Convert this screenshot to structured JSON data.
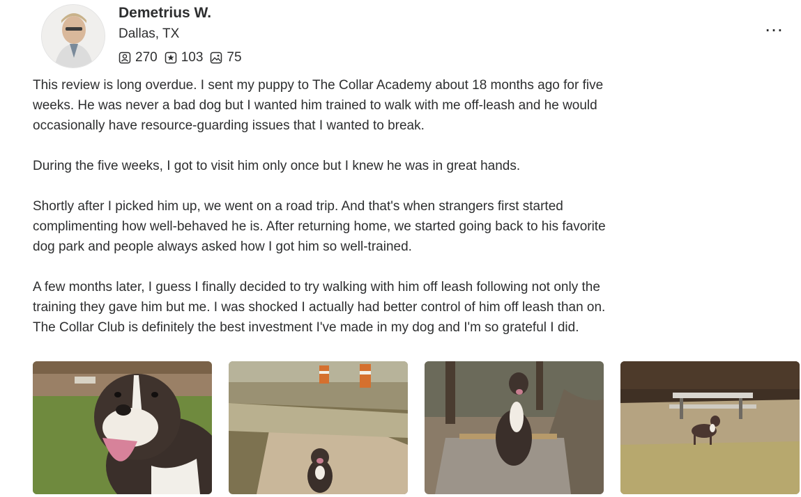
{
  "user": {
    "name": "Demetrius W.",
    "location": "Dallas, TX",
    "stats": {
      "reviews": "270",
      "ratings": "103",
      "photos": "75"
    }
  },
  "menu": {
    "more_label": "…"
  },
  "review": {
    "paragraphs": [
      "This review is long overdue.  I sent my puppy to The Collar Academy about 18 months ago for five\nweeks.  He was never a bad dog but I wanted him trained to walk with me off-leash and he would\noccasionally have resource-guarding issues that I wanted to break.",
      "During the five weeks, I got to visit him only once but I knew he was in great hands.",
      "Shortly after I picked him up, we went on a road trip.  And that's when strangers first started\ncomplimenting how well-behaved he is.  After returning home, we started going back to his favorite\ndog park and people always asked how I got him so well-trained.",
      "A few months later, I guess I finally decided to try walking with him off leash following not only the\ntraining they gave him but me.  I was shocked I actually had better control of him off leash than on.\n The Collar Club is definitely the best investment I've made in my dog and I'm so grateful I did."
    ]
  },
  "colors": {
    "text": "#2d2e2f",
    "grass": "#6f8a3e",
    "concrete": "#c9b79a",
    "dog_coat": "#3a2f2a"
  }
}
